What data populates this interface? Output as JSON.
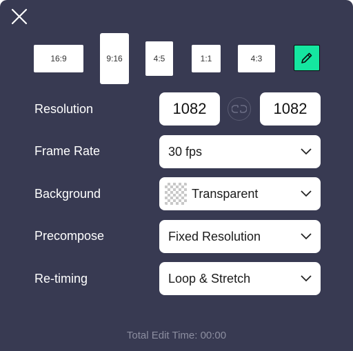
{
  "dialog": {
    "close_icon": "close-icon",
    "edit_icon": "pencil-icon"
  },
  "aspect_ratios": [
    {
      "label": "16:9"
    },
    {
      "label": "9:16"
    },
    {
      "label": "4:5"
    },
    {
      "label": "1:1"
    },
    {
      "label": "4:3"
    }
  ],
  "selected_ratio": "9:16",
  "rows": {
    "resolution": {
      "label": "Resolution",
      "width": "1082",
      "height": "1082",
      "link_icon": "link-icon"
    },
    "frame_rate": {
      "label": "Frame Rate",
      "value": "30 fps"
    },
    "background": {
      "label": "Background",
      "value": "Transparent",
      "swatch_icon": "transparent-checker-icon"
    },
    "precompose": {
      "label": "Precompose",
      "value": "Fixed Resolution"
    },
    "retiming": {
      "label": "Re-timing",
      "value": "Loop & Stretch"
    }
  },
  "footer": {
    "text": "Total Edit Time: 00:00"
  },
  "colors": {
    "panel_bg": "#383a52",
    "accent": "#15e6a0",
    "footer_text": "#8c8ea0"
  }
}
